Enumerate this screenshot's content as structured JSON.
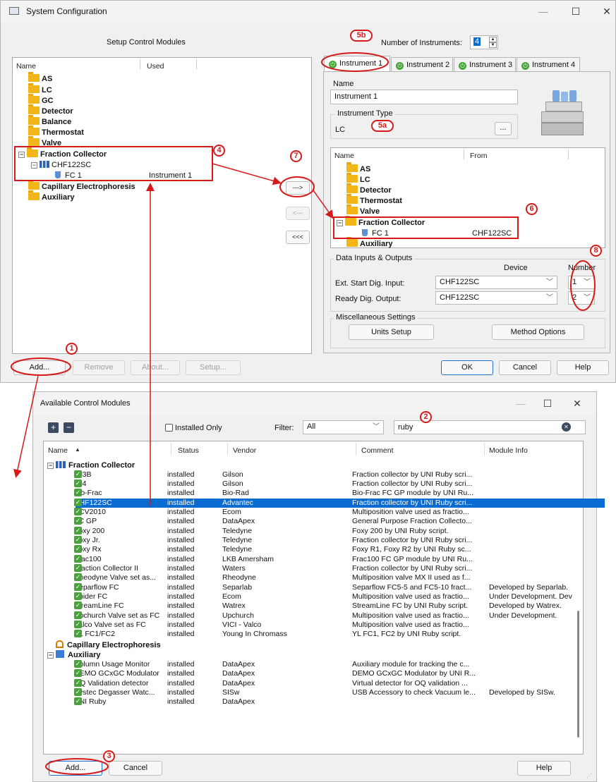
{
  "sys": {
    "title": "System Configuration",
    "setup_label": "Setup Control Modules",
    "left_cols": [
      "Name",
      "Used"
    ],
    "tree": [
      {
        "label": "AS",
        "used": ""
      },
      {
        "label": "LC",
        "used": ""
      },
      {
        "label": "GC",
        "used": ""
      },
      {
        "label": "Detector",
        "used": ""
      },
      {
        "label": "Balance",
        "used": ""
      },
      {
        "label": "Thermostat",
        "used": ""
      },
      {
        "label": "Valve",
        "used": ""
      },
      {
        "label": "Fraction Collector",
        "used": ""
      },
      {
        "label": "CHF122SC",
        "used": ""
      },
      {
        "label": "FC 1",
        "used": "Instrument 1"
      },
      {
        "label": "Capillary Electrophoresis",
        "used": ""
      },
      {
        "label": "Auxiliary",
        "used": ""
      }
    ],
    "num_instr_label": "Number of Instruments:",
    "num_instr_value": "4",
    "tabs": [
      "Instrument 1",
      "Instrument 2",
      "Instrument 3",
      "Instrument 4"
    ],
    "name_label": "Name",
    "name_value": "Instrument 1",
    "type_label": "Instrument Type",
    "type_value": "LC",
    "type_btn": "...",
    "right_cols": [
      "Name",
      "From"
    ],
    "right_tree": [
      {
        "label": "AS",
        "from": ""
      },
      {
        "label": "LC",
        "from": ""
      },
      {
        "label": "Detector",
        "from": ""
      },
      {
        "label": "Thermostat",
        "from": ""
      },
      {
        "label": "Valve",
        "from": ""
      },
      {
        "label": "Fraction Collector",
        "from": ""
      },
      {
        "label": "FC 1",
        "from": "CHF122SC"
      },
      {
        "label": "Auxiliary",
        "from": ""
      }
    ],
    "mid_btns": [
      "--->",
      "<---",
      "<<<"
    ],
    "dio_label": "Data Inputs & Outputs",
    "dio_device": "Device",
    "dio_number": "Number",
    "dio_rows": [
      {
        "label": "Ext. Start Dig. Input:",
        "device": "CHF122SC",
        "number": "1"
      },
      {
        "label": "Ready Dig. Output:",
        "device": "CHF122SC",
        "number": "2"
      }
    ],
    "misc_label": "Miscellaneous Settings",
    "units_btn": "Units Setup",
    "method_btn": "Method Options",
    "bottom_btns": [
      "Add...",
      "Remove",
      "About...",
      "Setup..."
    ],
    "ok": "OK",
    "cancel": "Cancel",
    "help": "Help"
  },
  "acm": {
    "title": "Available Control Modules",
    "installed_only": "Installed Only",
    "filter_label": "Filter:",
    "filter_value": "All",
    "search_value": "ruby",
    "cols": [
      "Name",
      "Status",
      "Vendor",
      "Comment",
      "Module Info"
    ],
    "group1": "Fraction Collector",
    "rows": [
      {
        "name": "203B",
        "status": "installed",
        "vendor": "Gilson",
        "comment": "Fraction collector by UNI Ruby scri...",
        "info": ""
      },
      {
        "name": "204",
        "status": "installed",
        "vendor": "Gilson",
        "comment": "Fraction collector by UNI Ruby scri...",
        "info": ""
      },
      {
        "name": "Bio-Frac",
        "status": "installed",
        "vendor": "Bio-Rad",
        "comment": "Bio-Frac FC GP module by UNI Ru...",
        "info": ""
      },
      {
        "name": "CHF122SC",
        "status": "installed",
        "vendor": "Advantec",
        "comment": "Fraction collector by UNI Ruby scri...",
        "info": ""
      },
      {
        "name": "ECV2010",
        "status": "installed",
        "vendor": "Ecom",
        "comment": "Multiposition valve used as fractio...",
        "info": ""
      },
      {
        "name": "FC GP",
        "status": "installed",
        "vendor": "DataApex",
        "comment": "General Purpose Fraction Collecto...",
        "info": ""
      },
      {
        "name": "Foxy 200",
        "status": "installed",
        "vendor": "Teledyne",
        "comment": "Foxy 200 by UNI Ruby script.",
        "info": ""
      },
      {
        "name": "Foxy Jr.",
        "status": "installed",
        "vendor": "Teledyne",
        "comment": "Fraction collector by UNI Ruby scri...",
        "info": ""
      },
      {
        "name": "Foxy Rx",
        "status": "installed",
        "vendor": "Teledyne",
        "comment": "Foxy R1, Foxy R2 by UNI Ruby sc...",
        "info": ""
      },
      {
        "name": "Frac100",
        "status": "installed",
        "vendor": "LKB Amersham",
        "comment": "Frac100 FC GP module by UNI Ru...",
        "info": ""
      },
      {
        "name": "Fraction Collector II",
        "status": "installed",
        "vendor": "Waters",
        "comment": "Fraction collector by UNI Ruby scri...",
        "info": ""
      },
      {
        "name": "Rheodyne Valve set as...",
        "status": "installed",
        "vendor": "Rheodyne",
        "comment": "Multiposition valve MX II used as f...",
        "info": ""
      },
      {
        "name": "Separflow FC",
        "status": "installed",
        "vendor": "Separlab",
        "comment": "Separflow FC5-5 and FC5-10 fract...",
        "info": "Developed by Separlab."
      },
      {
        "name": "Spider FC",
        "status": "installed",
        "vendor": "Ecom",
        "comment": "Multiposition valve used as fractio...",
        "info": "Under Development. Dev"
      },
      {
        "name": "StreamLine FC",
        "status": "installed",
        "vendor": "Watrex",
        "comment": "StreamLine FC by UNI Ruby script.",
        "info": "Developed by Watrex."
      },
      {
        "name": "Upchurch Valve set as FC",
        "status": "installed",
        "vendor": "Upchurch",
        "comment": "Multiposition valve used as fractio...",
        "info": "Under Development."
      },
      {
        "name": "Valco Valve set as FC",
        "status": "installed",
        "vendor": "VICI - Valco",
        "comment": "Multiposition valve used as fractio...",
        "info": ""
      },
      {
        "name": "YL FC1/FC2",
        "status": "installed",
        "vendor": "Young In Chromass",
        "comment": "YL FC1, FC2 by UNI Ruby script.",
        "info": ""
      }
    ],
    "group2": "Capillary Electrophoresis",
    "group3": "Auxiliary",
    "rows2": [
      {
        "name": "Column Usage Monitor",
        "status": "installed",
        "vendor": "DataApex",
        "comment": "Auxiliary module for tracking the c...",
        "info": ""
      },
      {
        "name": "DEMO GCxGC Modulator",
        "status": "installed",
        "vendor": "DataApex",
        "comment": "DEMO GCxGC Modulator by UNI R...",
        "info": ""
      },
      {
        "name": "OQ Validation detector",
        "status": "installed",
        "vendor": "DataApex",
        "comment": "Virtual detector for OQ validation ...",
        "info": ""
      },
      {
        "name": "Systec Degasser Watc...",
        "status": "installed",
        "vendor": "SISw",
        "comment": "USB Accessory to check Vacuum le...",
        "info": "Developed by SISw."
      },
      {
        "name": "UNI Ruby",
        "status": "installed",
        "vendor": "DataApex",
        "comment": "",
        "info": ""
      }
    ],
    "add": "Add...",
    "cancel": "Cancel",
    "help": "Help"
  },
  "callouts": [
    "1",
    "2",
    "3",
    "4",
    "5",
    "b",
    "5",
    "a",
    "6",
    "7",
    "8"
  ],
  "colors": {
    "accent": "#0a6bd0",
    "callout": "#d61a1a",
    "folder": "#f2b618",
    "check": "#48a33a"
  }
}
